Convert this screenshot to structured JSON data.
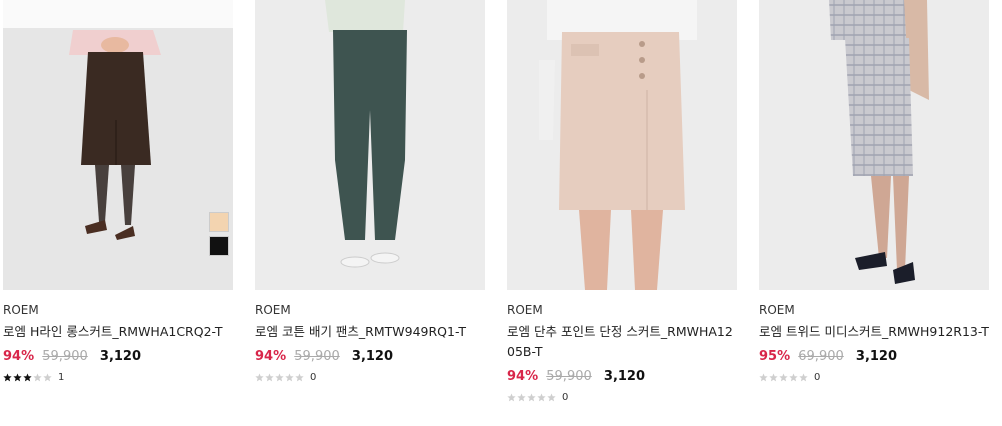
{
  "colors": {
    "discount": "#d8264a",
    "star_filled": "#111111",
    "star_empty": "#cfcfcf",
    "original_price": "#aaaaaa"
  },
  "products": [
    {
      "brand": "ROEM",
      "title": "로엠 H라인 롱스커트_RMWHA1CRQ2-T",
      "discount": "94%",
      "original_price": "59,900",
      "sale_price": "3,120",
      "rating": 3,
      "review_count": "1",
      "image": "brown-long-skirt",
      "swatches": [
        "#f3d4b0",
        "#111111"
      ]
    },
    {
      "brand": "ROEM",
      "title": "로엠 코튼 배기 팬츠_RMTW949RQ1-T",
      "discount": "94%",
      "original_price": "59,900",
      "sale_price": "3,120",
      "rating": 0,
      "review_count": "0",
      "image": "green-baggy-pants",
      "swatches": []
    },
    {
      "brand": "ROEM",
      "title": "로엠 단추 포인트 단정 스커트_RMWHA1205B-T",
      "discount": "94%",
      "original_price": "59,900",
      "sale_price": "3,120",
      "rating": 0,
      "review_count": "0",
      "image": "beige-button-skirt",
      "swatches": []
    },
    {
      "brand": "ROEM",
      "title": "로엠 트위드 미디스커트_RMWH912R13-T",
      "discount": "95%",
      "original_price": "69,900",
      "sale_price": "3,120",
      "rating": 0,
      "review_count": "0",
      "image": "tweed-midi-skirt",
      "swatches": []
    }
  ]
}
